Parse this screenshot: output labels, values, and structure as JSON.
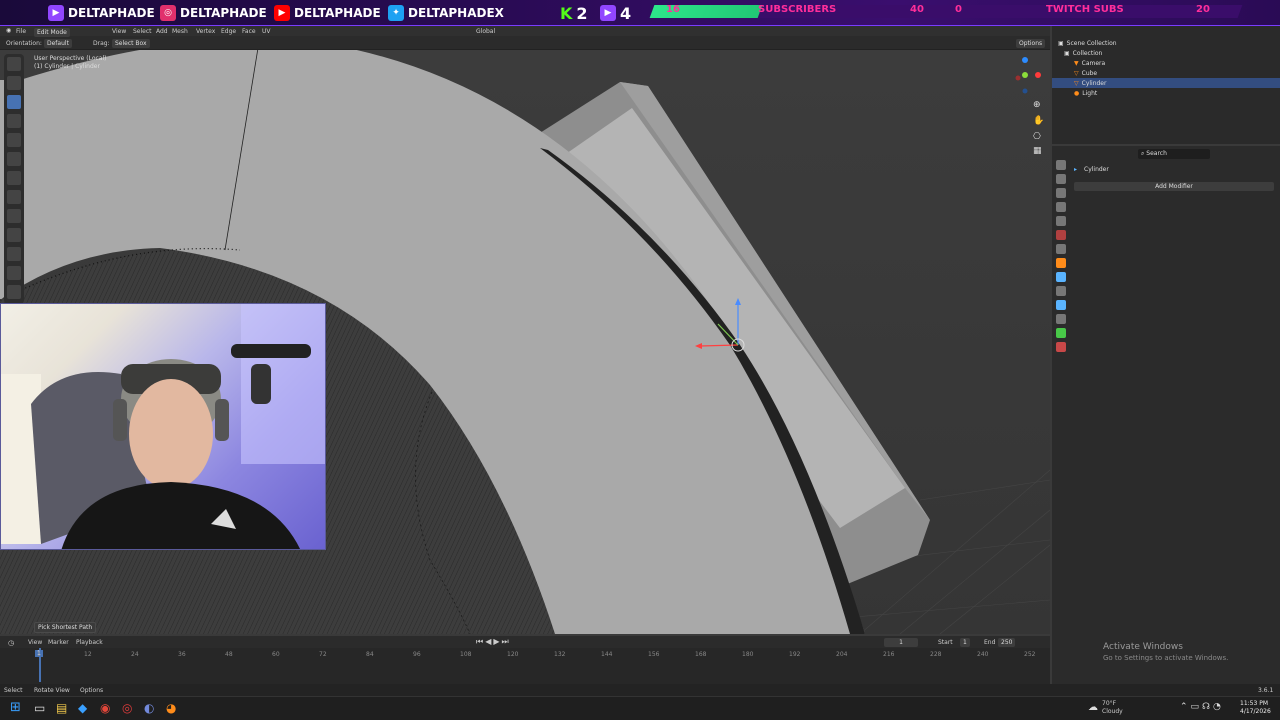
{
  "banner": {
    "socials": [
      {
        "platform_icon": "twitch-icon",
        "handle": "DELTAPHADE",
        "color": "#9146ff"
      },
      {
        "platform_icon": "instagram-icon",
        "handle": "DELTAPHADE",
        "color": "#e1306c"
      },
      {
        "platform_icon": "youtube-icon",
        "handle": "DELTAPHADE",
        "color": "#ff0000"
      },
      {
        "platform_icon": "twitter-icon",
        "handle": "DELTAPHADEX",
        "color": "#1da1f2"
      }
    ],
    "kick_count": "2",
    "twitch_count": "4",
    "subscribers_left": "16",
    "subscribers_label": "SUBSCRIBERS",
    "subscribers_goal": "40",
    "subs_current": "0",
    "twitch_subs_label": "TWITCH SUBS",
    "twitch_subs_goal": "20"
  },
  "topbar": {
    "menus": [
      "File"
    ]
  },
  "header": {
    "orientation_label": "Orientation:",
    "orientation_value": "Default",
    "drag_label": "Drag:",
    "drag_value": "Select Box",
    "mode": "Edit Mode",
    "menus": [
      "View",
      "Select",
      "Add",
      "Mesh",
      "Vertex",
      "Edge",
      "Face",
      "UV"
    ],
    "transform": "Global",
    "options": "Options"
  },
  "viewport": {
    "perspective": "User Perspective (Local)",
    "object": "(1) Cylinder | Cylinder",
    "operator_panel": "Pick Shortest Path"
  },
  "outliner": {
    "root": "Scene Collection",
    "collection": "Collection",
    "items": [
      "Camera",
      "Cube",
      "Cylinder",
      "Light"
    ],
    "selected": "Cylinder"
  },
  "properties": {
    "search_placeholder": "Search",
    "object_name": "Cylinder",
    "add_modifier": "Add Modifier"
  },
  "timeline": {
    "menus": [
      "View",
      "Marker",
      "Playback"
    ],
    "current_frame": "1",
    "start_label": "Start",
    "start": "1",
    "end_label": "End",
    "end": "250",
    "ticks": [
      "1",
      "12",
      "24",
      "36",
      "48",
      "60",
      "72",
      "84",
      "96",
      "108",
      "120",
      "132",
      "144",
      "156",
      "168",
      "180",
      "192",
      "204",
      "216",
      "228",
      "240",
      "252"
    ]
  },
  "status": {
    "select": "Select",
    "rotate": "Rotate View",
    "options": "Options",
    "version": "3.6.1"
  },
  "activate": {
    "title": "Activate Windows",
    "sub": "Go to Settings to activate Windows."
  },
  "taskbar": {
    "weather_temp": "70°F",
    "weather_desc": "Cloudy",
    "time": "11:53 PM",
    "date": "4/17/2026"
  },
  "colors": {
    "accent": "#4772b3",
    "select_orange": "#ff8c1a",
    "banner_pink": "#ff2e9a",
    "banner_green": "#53fc18"
  }
}
